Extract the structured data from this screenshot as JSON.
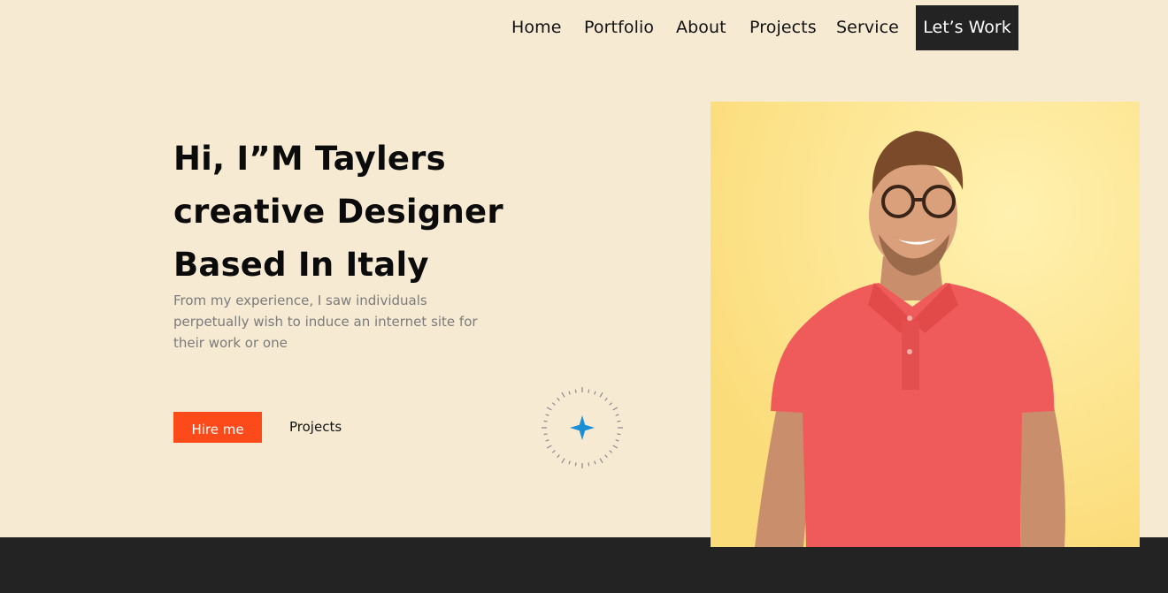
{
  "nav": {
    "links": [
      "Home",
      "Portfolio",
      "About",
      "Projects",
      "Service"
    ],
    "cta_label": "Let’s Work"
  },
  "hero": {
    "title_lines": [
      "Hi, I”M Taylers",
      "creative Designer",
      "Based In Italy"
    ],
    "description": "From my experience, I saw individuals perpetually wish to induce an internet site for their work or one",
    "hire_label": "Hire me",
    "projects_label": "Projects"
  },
  "decor": {
    "icon": "sparkle-icon",
    "accent": "#1a8fd6"
  },
  "photo": {
    "background": "#fde68a",
    "shirt": "#ef5b5b"
  },
  "colors": {
    "page_bg": "#f6ead3",
    "button": "#fc4a1a",
    "dark": "#232323"
  }
}
